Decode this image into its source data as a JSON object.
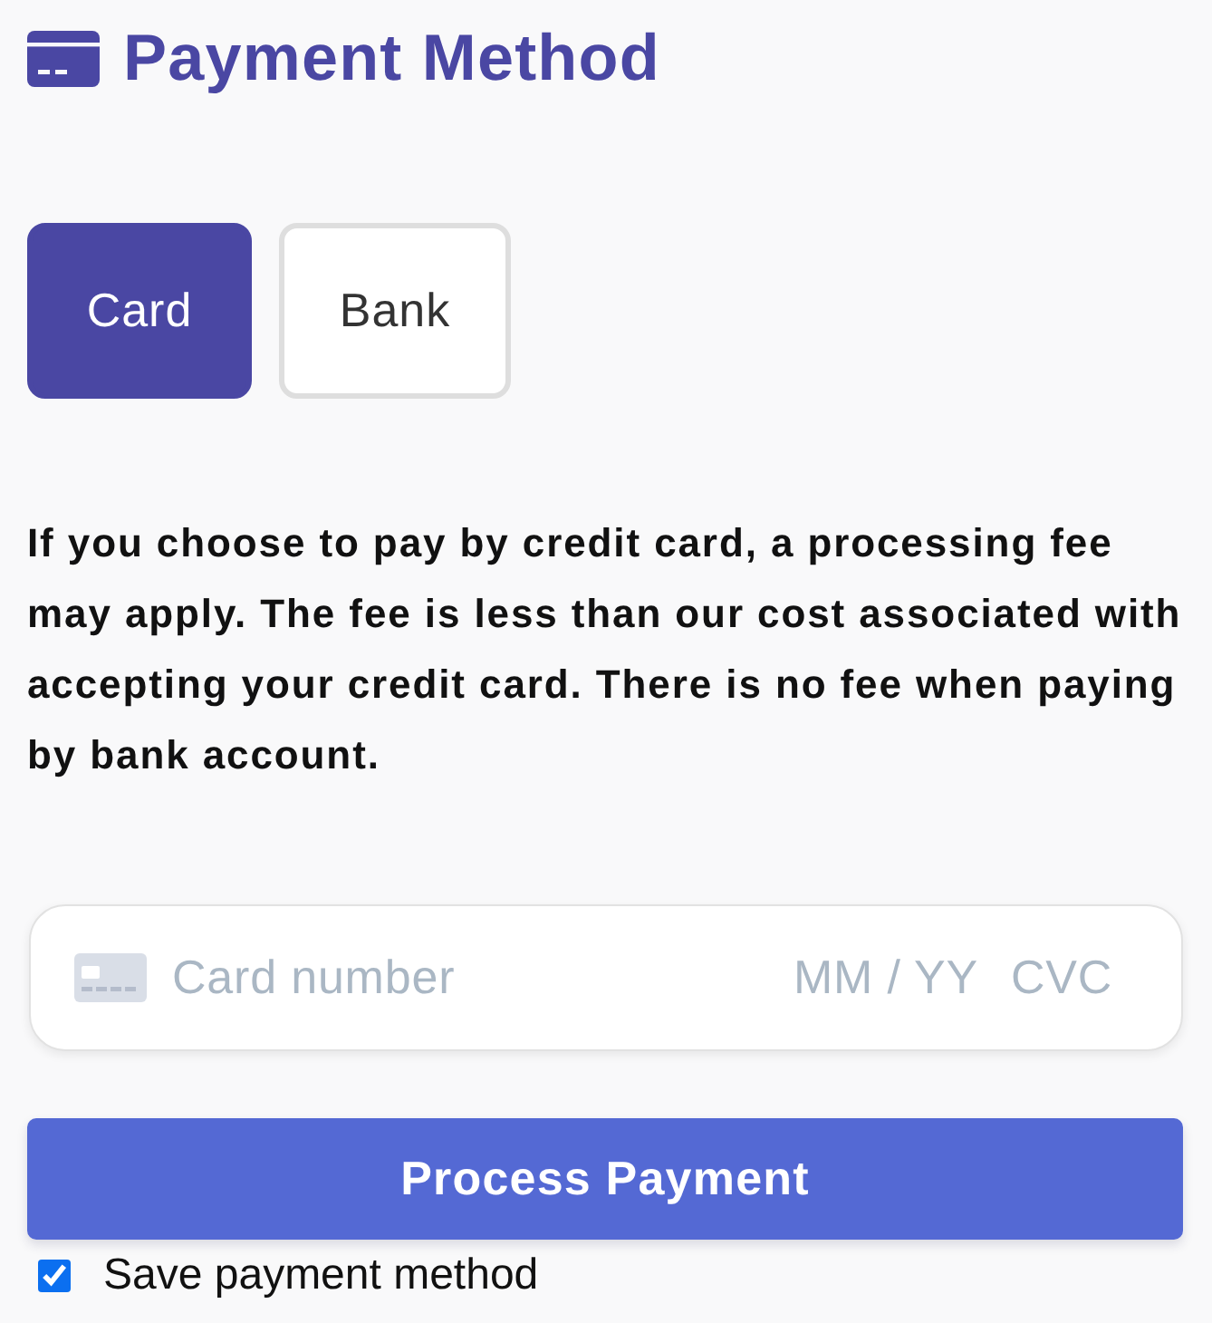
{
  "header": {
    "title": "Payment Method"
  },
  "tabs": [
    {
      "label": "Card",
      "selected": true
    },
    {
      "label": "Bank",
      "selected": false
    }
  ],
  "notice": "If you choose to pay by credit card, a processing fee may apply. The fee is less than our cost associated with accepting your credit card. There is no fee when paying by bank account.",
  "card_field": {
    "number_placeholder": "Card number",
    "expiry_placeholder": "MM / YY",
    "cvc_placeholder": "CVC"
  },
  "submit_button": {
    "label": "Process Payment"
  },
  "save_option": {
    "label": "Save payment method",
    "checked": true
  }
}
